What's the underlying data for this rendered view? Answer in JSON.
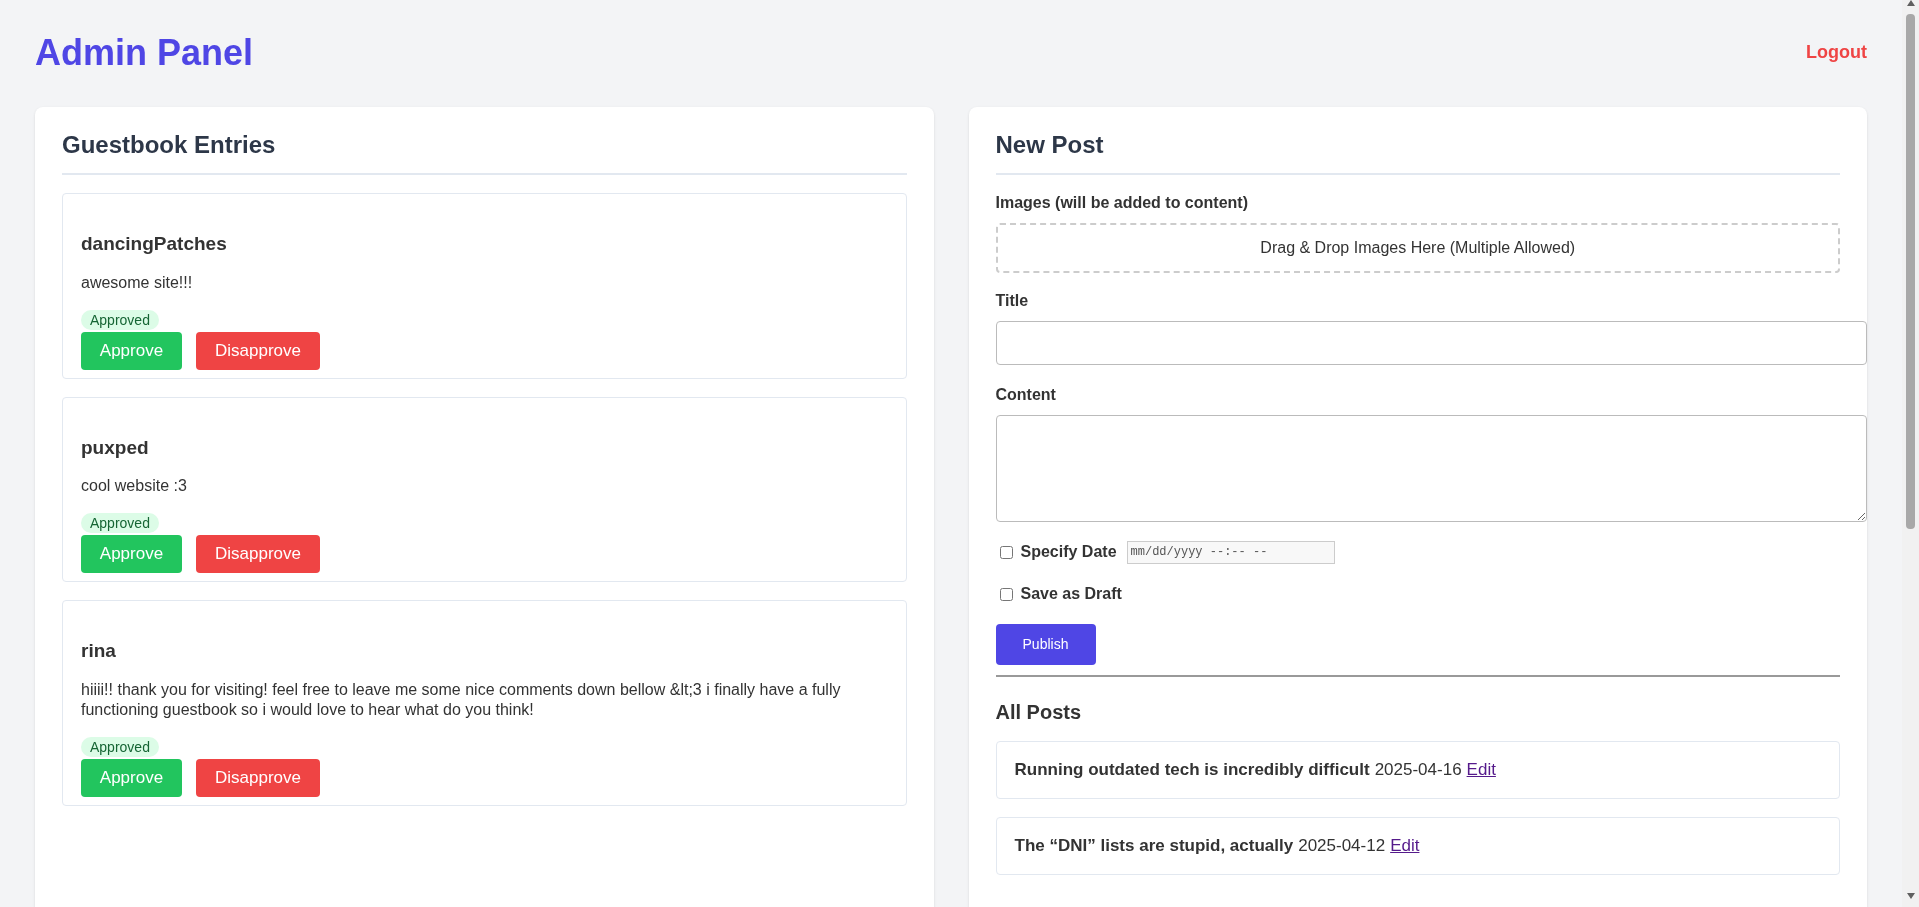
{
  "header": {
    "title": "Admin Panel",
    "logout": "Logout"
  },
  "guestbook": {
    "heading": "Guestbook Entries",
    "entries": [
      {
        "name": "dancingPatches",
        "message": "awesome site!!!",
        "status": "Approved",
        "approved": true,
        "approve_button": "Approve",
        "disapprove_button": "Disapprove"
      },
      {
        "name": "puxped",
        "message": "cool website :3",
        "status": "Approved",
        "approved": true,
        "approve_button": "Approve",
        "disapprove_button": "Disapprove"
      },
      {
        "name": "rina",
        "message": "hiiii!! thank you for visiting! feel free to leave me some nice comments down bellow &lt;3 i finally have a fully functioning guestbook so i would love to hear what do you think!",
        "status": "Approved",
        "approved": true,
        "approve_button": "Approve",
        "disapprove_button": "Disapprove"
      }
    ]
  },
  "new_post": {
    "heading": "New Post",
    "images_label": "Images (will be added to content)",
    "dropzone": "Drag & Drop Images Here (Multiple Allowed)",
    "title_label": "Title",
    "content_label": "Content",
    "options": [
      {
        "kind": "date",
        "label": "Specify Date",
        "checked": false,
        "format": "mm/dd/yyyy --:-- --"
      },
      {
        "kind": "plain",
        "label": "Save as Draft",
        "checked": false
      }
    ],
    "publish": "Publish"
  },
  "all_posts": {
    "heading": "All Posts",
    "posts": [
      {
        "title": "Running outdated tech is incredibly difficult",
        "date": "2025-04-16",
        "edit": "Edit"
      },
      {
        "title": "The “DNI” lists are stupid, actually",
        "date": "2025-04-12",
        "edit": "Edit"
      }
    ]
  }
}
